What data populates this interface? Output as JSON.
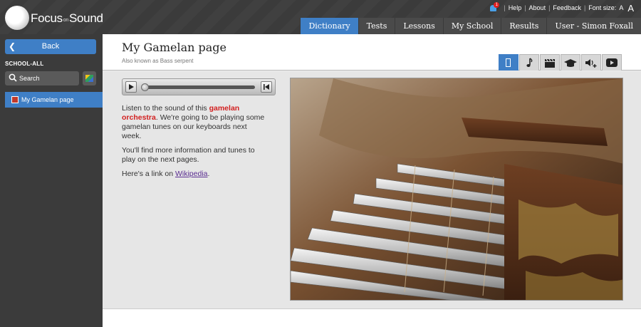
{
  "app": {
    "logo_text_left": "Focus",
    "logo_text_on": "on",
    "logo_text_right": "Sound"
  },
  "utility": {
    "notification_count": "1",
    "help": "Help",
    "about": "About",
    "feedback": "Feedback",
    "font_size_label": "Font size:",
    "font_small": "A",
    "font_large": "A"
  },
  "nav_tabs": [
    {
      "label": "Dictionary",
      "active": true
    },
    {
      "label": "Tests",
      "active": false
    },
    {
      "label": "Lessons",
      "active": false
    },
    {
      "label": "My School",
      "active": false
    },
    {
      "label": "Results",
      "active": false
    },
    {
      "label": "User - Simon Foxall",
      "active": false
    }
  ],
  "sidebar": {
    "back_label": "Back",
    "section_label": "SCHOOL-ALL",
    "search_label": "Search",
    "items": [
      {
        "label": "My Gamelan page",
        "color": "#c0392b"
      }
    ]
  },
  "page": {
    "title": "My Gamelan page",
    "subtitle": "Also known as Bass serpent"
  },
  "media_tabs": [
    {
      "icon": "book-icon",
      "active": true
    },
    {
      "icon": "music-note-icon",
      "active": false
    },
    {
      "icon": "clapperboard-icon",
      "active": false
    },
    {
      "icon": "graduation-cap-icon",
      "active": false
    },
    {
      "icon": "speaker-add-icon",
      "active": false
    },
    {
      "icon": "play-icon",
      "active": false
    }
  ],
  "player": {
    "progress_fraction": 0
  },
  "body": {
    "p1_before": "Listen to the sound of this ",
    "p1_highlight": "gamelan orchestra",
    "p1_after": ". We're going to be playing some gamelan tunes on our keyboards next week.",
    "p2": "You'll find more information and tunes to play on the next pages.",
    "p3_before": "Here's a link on ",
    "p3_link": "Wikipedia",
    "p3_after": "."
  },
  "colors": {
    "accent": "#3f7fc6",
    "highlight": "#d21f1f",
    "link": "#5a2d91"
  }
}
